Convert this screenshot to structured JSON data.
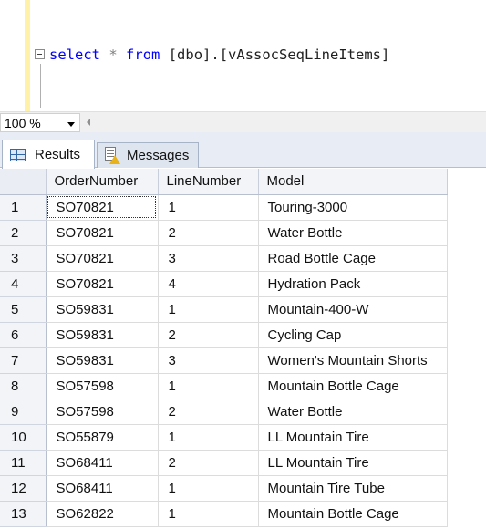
{
  "editor": {
    "query": {
      "kw_select": "select",
      "star": "*",
      "kw_from": "from",
      "object": "[dbo].[vAssocSeqLineItems]"
    }
  },
  "zoom": {
    "value": "100 %"
  },
  "tabs": [
    {
      "label": "Results",
      "icon": "grid-icon",
      "active": true
    },
    {
      "label": "Messages",
      "icon": "messages-icon",
      "active": false
    }
  ],
  "grid": {
    "columns": [
      "OrderNumber",
      "LineNumber",
      "Model"
    ],
    "rows": [
      {
        "n": "1",
        "order": "SO70821",
        "line": "1",
        "model": "Touring-3000"
      },
      {
        "n": "2",
        "order": "SO70821",
        "line": "2",
        "model": "Water Bottle"
      },
      {
        "n": "3",
        "order": "SO70821",
        "line": "3",
        "model": "Road Bottle Cage"
      },
      {
        "n": "4",
        "order": "SO70821",
        "line": "4",
        "model": "Hydration Pack"
      },
      {
        "n": "5",
        "order": "SO59831",
        "line": "1",
        "model": "Mountain-400-W"
      },
      {
        "n": "6",
        "order": "SO59831",
        "line": "2",
        "model": "Cycling Cap"
      },
      {
        "n": "7",
        "order": "SO59831",
        "line": "3",
        "model": "Women's Mountain Shorts"
      },
      {
        "n": "8",
        "order": "SO57598",
        "line": "1",
        "model": "Mountain Bottle Cage"
      },
      {
        "n": "9",
        "order": "SO57598",
        "line": "2",
        "model": "Water Bottle"
      },
      {
        "n": "10",
        "order": "SO55879",
        "line": "1",
        "model": "LL Mountain Tire"
      },
      {
        "n": "11",
        "order": "SO68411",
        "line": "2",
        "model": "LL Mountain Tire"
      },
      {
        "n": "12",
        "order": "SO68411",
        "line": "1",
        "model": "Mountain Tire Tube"
      },
      {
        "n": "13",
        "order": "SO62822",
        "line": "1",
        "model": "Mountain Bottle Cage"
      }
    ]
  },
  "colors": {
    "keyword": "#0000ff",
    "editor_margin": "#fff2a8",
    "tab_bar": "#e8edf5"
  }
}
